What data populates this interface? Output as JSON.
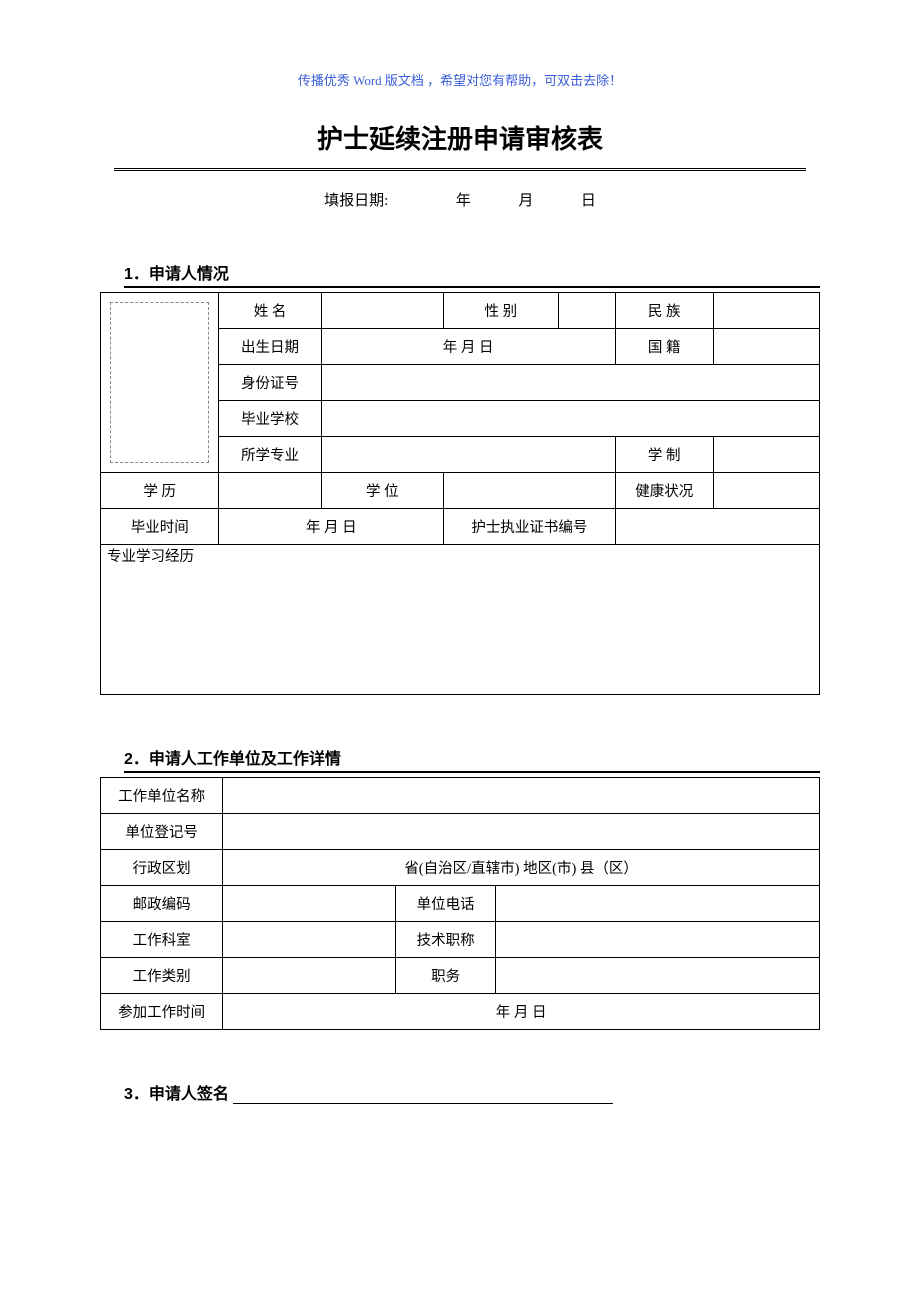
{
  "header_note": "传播优秀 Word 版文档 ，希望对您有帮助，可双击去除！",
  "title": "护士延续注册申请审核表",
  "fill_date": {
    "label": "填报日期:",
    "year": "年",
    "month": "月",
    "day": "日"
  },
  "section1": {
    "heading": "1．申请人情况",
    "labels": {
      "name": "姓        名",
      "sex": "性        别",
      "ethnic": "民        族",
      "dob": "出生日期",
      "dob_value": "年        月        日",
      "nationality": "国        籍",
      "id": "身份证号",
      "school": "毕业学校",
      "major": "所学专业",
      "degree_system": "学        制",
      "education": "学        历",
      "degree": "学        位",
      "health": "健康状况",
      "grad_time": "毕业时间",
      "grad_value": "年      月      日",
      "cert_no": "护士执业证书编号",
      "study_history": "专业学习经历"
    }
  },
  "section2": {
    "heading": "2．申请人工作单位及工作详情",
    "labels": {
      "work_unit": "工作单位名称",
      "reg_no": "单位登记号",
      "admin_div": "行政区划",
      "admin_div_value": "省(自治区/直辖市)             地区(市)             县（区）",
      "postcode": "邮政编码",
      "unit_phone": "单位电话",
      "dept": "工作科室",
      "tech_title": "技术职称",
      "work_type": "工作类别",
      "position": "职务",
      "start_work": "参加工作时间",
      "start_work_value": "年            月          日"
    }
  },
  "section3": {
    "heading": "3．申请人签名"
  }
}
